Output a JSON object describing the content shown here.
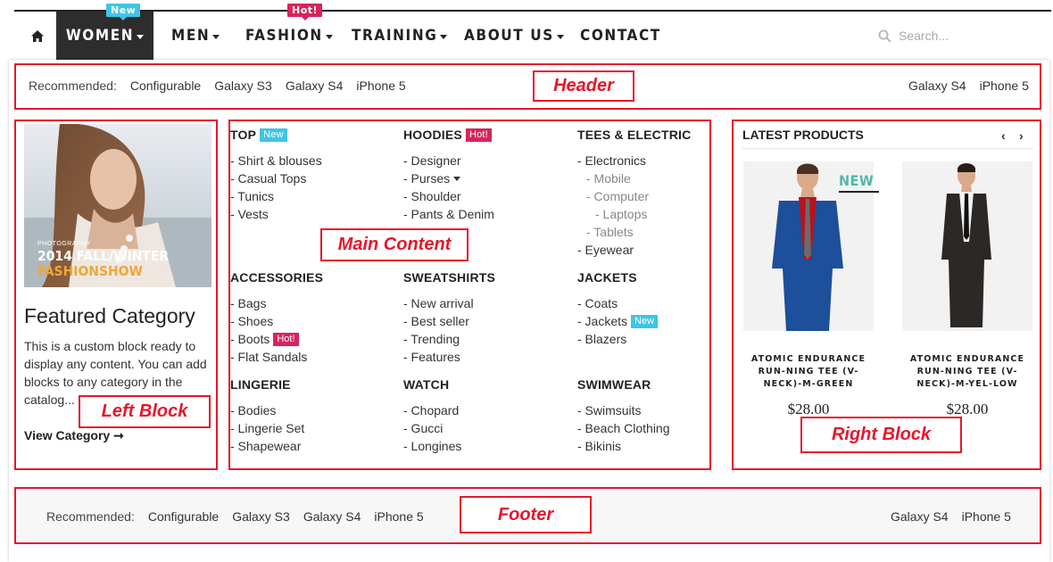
{
  "nav": {
    "items": [
      {
        "label": "WOMEN",
        "badge": "New"
      },
      {
        "label": "MEN"
      },
      {
        "label": "FASHION",
        "badge": "Hot!"
      },
      {
        "label": "TRAINING"
      },
      {
        "label": "ABOUT US"
      },
      {
        "label": "CONTACT"
      }
    ],
    "search_placeholder": "Search..."
  },
  "header_bar": {
    "prefix": "Recommended:",
    "left_links": [
      "Configurable",
      "Galaxy S3",
      "Galaxy S4",
      "iPhone 5"
    ],
    "right_links": [
      "Galaxy S4",
      "iPhone 5"
    ]
  },
  "footer_bar": {
    "prefix": "Recommended:",
    "left_links": [
      "Configurable",
      "Galaxy S3",
      "Galaxy S4",
      "iPhone 5"
    ],
    "right_links": [
      "Galaxy S4",
      "iPhone 5"
    ]
  },
  "annotations": {
    "header": "Header",
    "main": "Main Content",
    "left": "Left Block",
    "right": "Right Block",
    "footer": "Footer"
  },
  "left_block": {
    "image_text_small": "PHOTOGRAPHY",
    "image_text_line1": "2014 FALL/WINTER",
    "image_text_line2": "FASHIONSHOW",
    "title": "Featured Category",
    "text": "This is a custom block ready to display any content. You can add blocks to any category in the catalog...",
    "link": "View Category ➞"
  },
  "menu": {
    "columns": [
      {
        "title": "TOP",
        "tag": "New",
        "items": [
          "- Shirt & blouses",
          "- Casual Tops",
          "- Tunics",
          "- Vests"
        ]
      },
      {
        "title": "HOODIES",
        "tag": "Hot!",
        "items": [
          "- Designer",
          "- Purses",
          "- Shoulder",
          "- Pants & Denim"
        ]
      },
      {
        "title": "TEES & ELECTRIC",
        "items": [
          "- Electronics",
          "- Mobile",
          "- Computer",
          "- Laptops",
          "- Tablets",
          "- Eyewear"
        ]
      },
      {
        "title": "ACCESSORIES",
        "items": [
          "- Bags",
          "- Shoes",
          "- Boots",
          "- Flat Sandals"
        ],
        "item_tags": {
          "2": "Hot!"
        }
      },
      {
        "title": "SWEATSHIRTS",
        "items": [
          "- New arrival",
          "- Best seller",
          "- Trending",
          "- Features"
        ]
      },
      {
        "title": "JACKETS",
        "items": [
          "- Coats",
          "- Jackets",
          "- Blazers"
        ],
        "item_tags": {
          "1": "New"
        }
      },
      {
        "title": "LINGERIE",
        "items": [
          "- Bodies",
          "- Lingerie Set",
          "- Shapewear"
        ]
      },
      {
        "title": "WATCH",
        "items": [
          "- Chopard",
          "- Gucci",
          "- Longines"
        ]
      },
      {
        "title": "SWIMWEAR",
        "items": [
          "- Swimsuits",
          "- Beach Clothing",
          "- Bikinis"
        ]
      }
    ]
  },
  "right_block": {
    "title": "LATEST PRODUCTS",
    "prev": "‹",
    "next": "›",
    "new_mark": "NEW",
    "products": [
      {
        "name": "ATOMIC ENDURANCE RUN-NING TEE (V-NECK)-M-GREEN",
        "price": "$28.00",
        "suit_color": "#1d4f9a",
        "tie_color": "#6b6b6b",
        "shirt_color": "#b8121e"
      },
      {
        "name": "ATOMIC ENDURANCE RUN-NING TEE (V-NECK)-M-YEL-LOW",
        "price": "$28.00",
        "suit_color": "#2c2826",
        "tie_color": "#111111",
        "shirt_color": "#f2f2f2"
      }
    ]
  },
  "colors": {
    "annotation_red": "#e6162c",
    "badge_new": "#3fc5e6",
    "badge_hot": "#d6245c",
    "active_nav_bg": "#2d2d2d"
  }
}
